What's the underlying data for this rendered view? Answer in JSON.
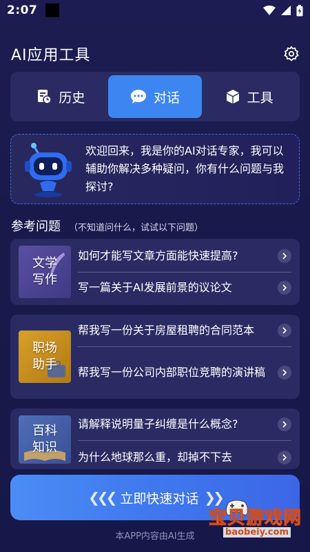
{
  "status_bar": {
    "time": "2:07"
  },
  "header": {
    "title": "AI应用工具",
    "settings_icon": "gear-icon"
  },
  "tabs": [
    {
      "label": "历史",
      "icon": "history-doc-icon",
      "active": false
    },
    {
      "label": "对话",
      "icon": "chat-bubble-icon",
      "active": true
    },
    {
      "label": "工具",
      "icon": "cube-icon",
      "active": false
    }
  ],
  "welcome": {
    "text": "欢迎回来，我是你的AI对话专家，我可以辅助你解决多种疑问，你有什么问题与我探讨?"
  },
  "reference": {
    "title": "参考问题",
    "subtitle": "（不知道问什么，试试以下问题）"
  },
  "question_groups": [
    {
      "category": "文学写作",
      "category_lines": [
        "文学",
        "写作"
      ],
      "questions": [
        "如何才能写文章方面能快速提高?",
        "写一篇关于AI发展前景的议论文"
      ]
    },
    {
      "category": "职场助手",
      "category_lines": [
        "职场",
        "助手"
      ],
      "questions": [
        "帮我写一份关于房屋租聘的合同范本",
        "帮我写一份公司内部职位竞聘的演讲稿"
      ]
    },
    {
      "category": "百科知识",
      "category_lines": [
        "百科",
        "知识"
      ],
      "questions": [
        "请解释说明量子纠缠是什么概念?",
        "为什么地球那么重，却掉不下去"
      ]
    }
  ],
  "cta": {
    "label": "立即快速对话"
  },
  "footer": {
    "note": "本APP内容由AI生成"
  },
  "watermark": {
    "text": "宝贝游戏网",
    "url": "baobeiy.com"
  },
  "colors": {
    "accent": "#3d86f2",
    "background": "#1b1b4f",
    "card": "#2a2b63"
  }
}
